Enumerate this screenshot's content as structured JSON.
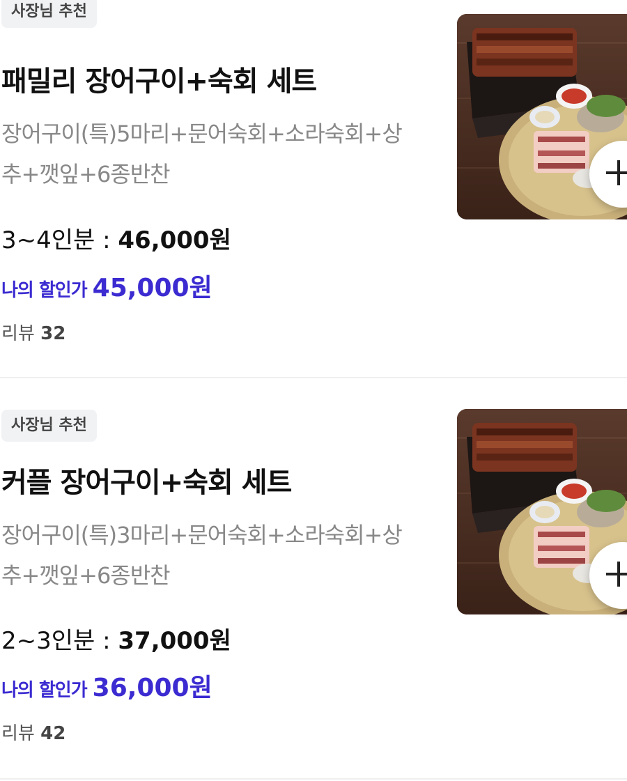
{
  "menu_items": [
    {
      "badge": "사장님 추천",
      "title": "패밀리 장어구이+숙회 세트",
      "description": "장어구이(특)5마리+문어숙회+소라숙회+상추+깻잎+6종반찬",
      "serving": "3~4인분 : ",
      "price": "46,000원",
      "discount_label": "나의 할인가",
      "discount_price": "45,000원",
      "review_label": "리뷰",
      "review_count": "32",
      "image_icon": "food-photo",
      "add_icon": "plus-icon"
    },
    {
      "badge": "사장님 추천",
      "title": "커플 장어구이+숙회 세트",
      "description": "장어구이(특)3마리+문어숙회+소라숙회+상추+깻잎+6종반찬",
      "serving": "2~3인분 : ",
      "price": "37,000원",
      "discount_label": "나의 할인가",
      "discount_price": "36,000원",
      "review_label": "리뷰",
      "review_count": "42",
      "image_icon": "food-photo",
      "add_icon": "plus-icon"
    }
  ],
  "colors": {
    "discount": "#3b2bd1",
    "badge_bg": "#f1f2f4",
    "description": "#888888",
    "divider": "#efefef"
  }
}
